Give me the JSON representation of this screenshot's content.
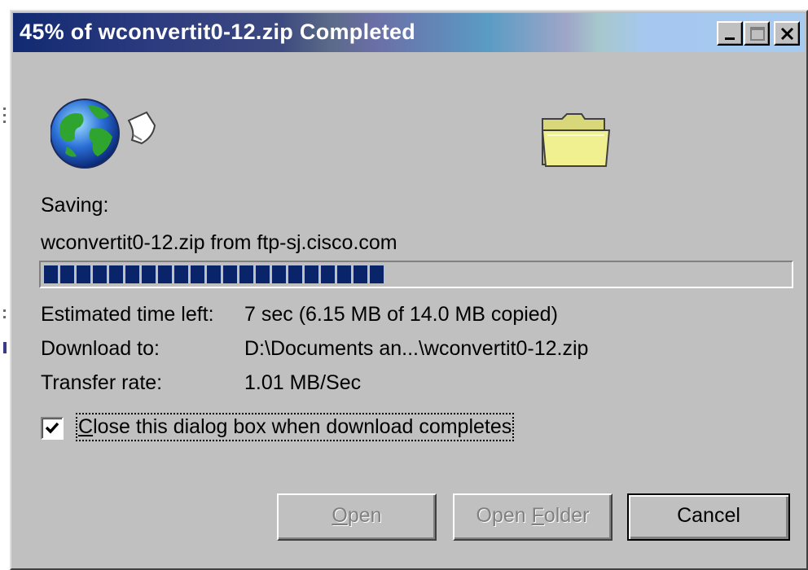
{
  "window": {
    "title": "45% of wconvertit0-12.zip Completed"
  },
  "titlebar_buttons": {
    "minimize_icon": "minimize-icon",
    "maximize_icon": "maximize-icon",
    "close_icon": "close-icon"
  },
  "icons": {
    "source": "globe-document-icon",
    "destination": "folder-icon"
  },
  "saving": {
    "label": "Saving:",
    "source": "wconvertit0-12.zip from ftp-sj.cisco.com"
  },
  "progress": {
    "percent": 45,
    "color": "#0a246a"
  },
  "details": {
    "time_left_label": "Estimated time left:",
    "time_left_value": "7 sec (6.15 MB of 14.0 MB copied)",
    "download_to_label": "Download to:",
    "download_to_value": "D:\\Documents an...\\wconvertit0-12.zip",
    "transfer_rate_label": "Transfer rate:",
    "transfer_rate_value": "1.01 MB/Sec"
  },
  "close_when_done": {
    "checked": true,
    "label_mnemonic": "C",
    "label_rest": "lose this dialog box when download completes"
  },
  "buttons": {
    "open_mnemonic": "O",
    "open_rest": "pen",
    "open_folder_prefix": "Open ",
    "open_folder_mnemonic": "F",
    "open_folder_rest": "older",
    "cancel": "Cancel"
  }
}
